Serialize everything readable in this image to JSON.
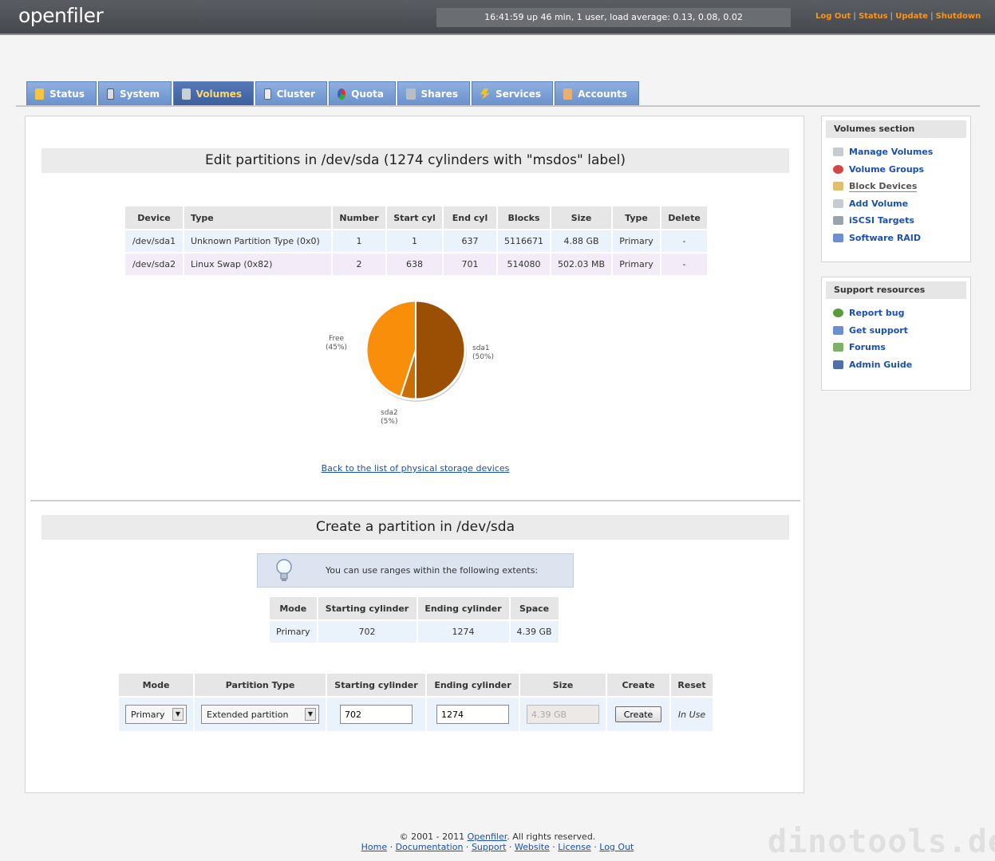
{
  "header": {
    "logo": "openfiler",
    "uptime": "16:41:59 up 46 min, 1 user, load average: 0.13, 0.08, 0.02",
    "links": [
      "Log Out",
      "Status",
      "Update",
      "Shutdown"
    ]
  },
  "tabs": [
    {
      "label": "Status",
      "icon": "status-icon"
    },
    {
      "label": "System",
      "icon": "system-icon"
    },
    {
      "label": "Volumes",
      "icon": "volumes-icon",
      "active": true
    },
    {
      "label": "Cluster",
      "icon": "cluster-icon"
    },
    {
      "label": "Quota",
      "icon": "quota-icon"
    },
    {
      "label": "Shares",
      "icon": "shares-icon"
    },
    {
      "label": "Services",
      "icon": "services-icon"
    },
    {
      "label": "Accounts",
      "icon": "accounts-icon"
    }
  ],
  "edit_section": {
    "title": "Edit partitions in /dev/sda (1274 cylinders with \"msdos\" label)",
    "columns": [
      "Device",
      "Type",
      "Number",
      "Start cyl",
      "End cyl",
      "Blocks",
      "Size",
      "Type",
      "Delete"
    ],
    "rows": [
      [
        "/dev/sda1",
        "Unknown Partition Type (0x0)",
        "1",
        "1",
        "637",
        "5116671",
        "4.88 GB",
        "Primary",
        "-"
      ],
      [
        "/dev/sda2",
        "Linux Swap (0x82)",
        "2",
        "638",
        "701",
        "514080",
        "502.03 MB",
        "Primary",
        "-"
      ]
    ],
    "back_link": "Back to the list of physical storage devices"
  },
  "chart_data": {
    "type": "pie",
    "categories": [
      "sda1",
      "sda2",
      "Free"
    ],
    "values": [
      50,
      5,
      45
    ],
    "labels": [
      "(50%)",
      "(5%)",
      "(45%)"
    ],
    "colors": [
      "#9a4f05",
      "#cc6e08",
      "#f98e0b"
    ]
  },
  "create_section": {
    "title": "Create a partition in /dev/sda",
    "hint": "You can use ranges within the following extents:",
    "extents_columns": [
      "Mode",
      "Starting cylinder",
      "Ending cylinder",
      "Space"
    ],
    "extents_row": [
      "Primary",
      "702",
      "1274",
      "4.39 GB"
    ],
    "form_columns": [
      "Mode",
      "Partition Type",
      "Starting cylinder",
      "Ending cylinder",
      "Size",
      "Create",
      "Reset"
    ],
    "form": {
      "mode": "Primary",
      "partition_type": "Extended partition",
      "start": "702",
      "end": "1274",
      "size": "4.39 GB",
      "create_label": "Create",
      "reset_text": "In Use"
    }
  },
  "sidebar": {
    "volumes_title": "Volumes section",
    "volumes_items": [
      {
        "label": "Manage Volumes",
        "icon": "manage-volumes-icon"
      },
      {
        "label": "Volume Groups",
        "icon": "volume-groups-icon"
      },
      {
        "label": "Block Devices",
        "icon": "block-devices-icon",
        "current": true
      },
      {
        "label": "Add Volume",
        "icon": "add-volume-icon"
      },
      {
        "label": "iSCSI Targets",
        "icon": "iscsi-targets-icon"
      },
      {
        "label": "Software RAID",
        "icon": "software-raid-icon"
      }
    ],
    "support_title": "Support resources",
    "support_items": [
      {
        "label": "Report bug",
        "icon": "bug-icon"
      },
      {
        "label": "Get support",
        "icon": "support-icon"
      },
      {
        "label": "Forums",
        "icon": "forums-icon"
      },
      {
        "label": "Admin Guide",
        "icon": "admin-guide-icon"
      }
    ]
  },
  "footer": {
    "copyright_prefix": "© 2001 - 2011",
    "brand": "Openfiler",
    "copyright_suffix": ". All rights reserved.",
    "links": [
      "Home",
      "Documentation",
      "Support",
      "Website",
      "License",
      "Log Out"
    ]
  },
  "watermark": "dinotools.de"
}
